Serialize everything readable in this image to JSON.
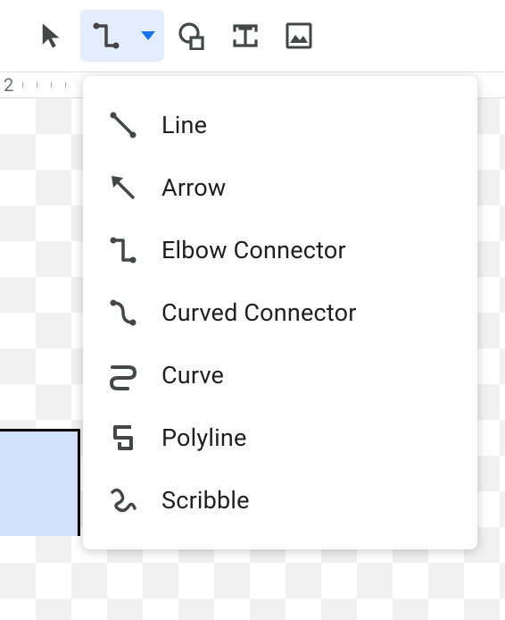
{
  "toolbar": {
    "select_tool": "Select",
    "line_tool": "Line",
    "shape_tool": "Shape",
    "textbox_tool": "Text box",
    "image_tool": "Insert image"
  },
  "ruler": {
    "label": "2"
  },
  "line_menu": {
    "items": [
      {
        "id": "line",
        "label": "Line"
      },
      {
        "id": "arrow",
        "label": "Arrow"
      },
      {
        "id": "elbow",
        "label": "Elbow Connector"
      },
      {
        "id": "curved",
        "label": "Curved Connector"
      },
      {
        "id": "curve",
        "label": "Curve"
      },
      {
        "id": "polyline",
        "label": "Polyline"
      },
      {
        "id": "scribble",
        "label": "Scribble"
      }
    ]
  }
}
